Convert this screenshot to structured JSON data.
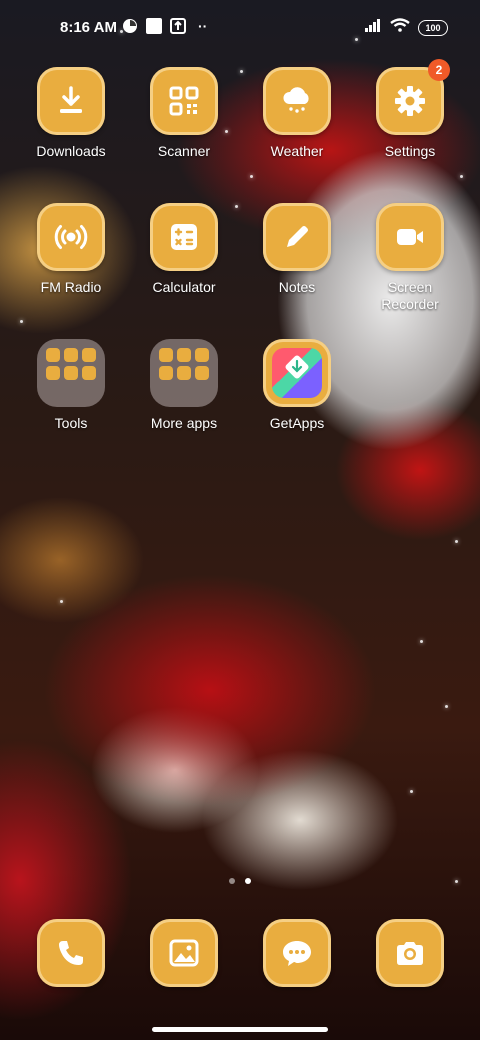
{
  "status_bar": {
    "time": "8:16 AM",
    "battery": "100",
    "more": "··"
  },
  "apps": [
    {
      "label": "Downloads",
      "icon": "download-icon"
    },
    {
      "label": "Scanner",
      "icon": "qr-scanner-icon"
    },
    {
      "label": "Weather",
      "icon": "weather-icon"
    },
    {
      "label": "Settings",
      "icon": "gear-icon",
      "badge": "2"
    },
    {
      "label": "FM Radio",
      "icon": "radio-icon"
    },
    {
      "label": "Calculator",
      "icon": "calculator-icon"
    },
    {
      "label": "Notes",
      "icon": "pencil-icon"
    },
    {
      "label": "Screen\nRecorder",
      "icon": "video-camera-icon"
    },
    {
      "label": "Tools",
      "icon": "folder-icon"
    },
    {
      "label": "More apps",
      "icon": "folder-icon"
    },
    {
      "label": "GetApps",
      "icon": "getapps-icon"
    }
  ],
  "dock": [
    {
      "icon": "phone-icon"
    },
    {
      "icon": "gallery-icon"
    },
    {
      "icon": "messages-icon"
    },
    {
      "icon": "camera-icon"
    }
  ],
  "colors": {
    "tile": "#e9ad3f",
    "badge": "#f05a28"
  }
}
